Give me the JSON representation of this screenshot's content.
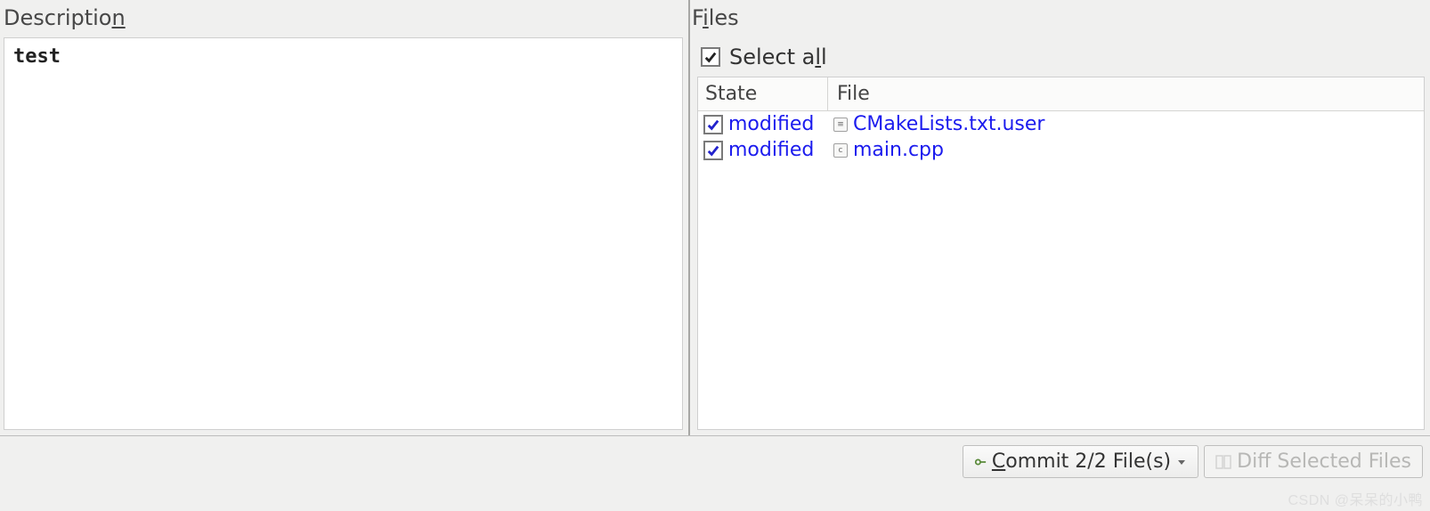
{
  "description": {
    "label_pre": "Descriptio",
    "label_accel": "n",
    "label_post": "",
    "text": "test"
  },
  "files": {
    "label_pre": "F",
    "label_accel": "i",
    "label_post": "les",
    "select_all": {
      "checked": true,
      "label_pre": "Select a",
      "label_accel": "l",
      "label_post": "l"
    },
    "columns": {
      "state": "State",
      "file": "File"
    },
    "rows": [
      {
        "checked": true,
        "state": "modified",
        "icon_glyph": "≡",
        "file": "CMakeLists.txt.user"
      },
      {
        "checked": true,
        "state": "modified",
        "icon_glyph": "c",
        "file": "main.cpp"
      }
    ]
  },
  "buttons": {
    "commit": {
      "label_pre": "",
      "label_accel": "C",
      "label_post": "ommit 2/2 File(s)",
      "enabled": true
    },
    "diff": {
      "label": "Diff Selected Files",
      "enabled": false
    }
  },
  "watermark": "CSDN @呆呆的小鸭"
}
